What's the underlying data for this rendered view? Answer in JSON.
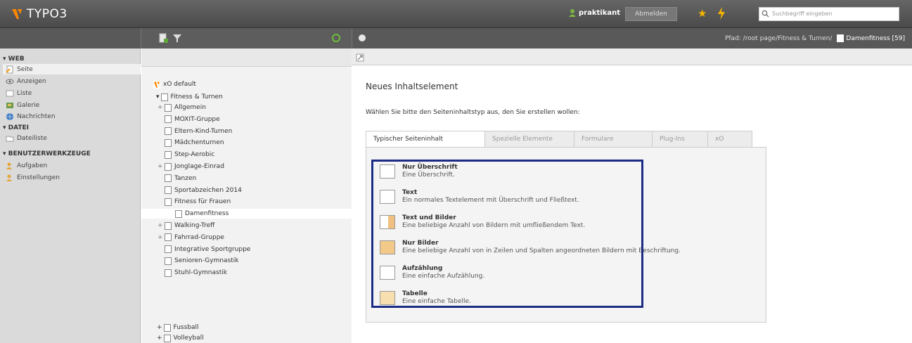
{
  "app": {
    "logo_text": "TYPO3",
    "user_name": "praktikant",
    "logout_label": "Abmelden",
    "search_placeholder": "Suchbegriff eingeben",
    "colors": {
      "topbar": "#4a4a4a",
      "accent": "#f5b400",
      "highlight": "#1b2c85"
    }
  },
  "path": {
    "label": "Pfad: /root page/Fitness & Turnen/",
    "page": "Damenfitness [59]"
  },
  "modules": {
    "web_section": "WEB",
    "web_items": [
      "Seite",
      "Anzeigen",
      "Liste",
      "Galerie",
      "Nachrichten"
    ],
    "files_section": "DATEI",
    "files_items": [
      "Dateiliste"
    ],
    "tools_section": "BENUTZERWERKZEUGE",
    "tools_items": [
      "Aufgaben",
      "Einstellungen"
    ]
  },
  "tree": {
    "root": "xO default",
    "parent": "Fitness & Turnen",
    "items": [
      "Allgemein",
      "MOXIT-Gruppe",
      "Eltern-Kind-Turnen",
      "Mädchenturnen",
      "Step-Aerobic",
      "Jonglage-Einrad",
      "Tanzen",
      "Sportabzeichen 2014",
      "Fitness für Frauen",
      "Damenfitness",
      "Walking-Treff",
      "Fahrrad-Gruppe",
      "Integrative Sportgruppe",
      "Senioren-Gymnastik",
      "Stuhl-Gymnastik"
    ],
    "siblings": [
      "Fussball",
      "Volleyball"
    ]
  },
  "content": {
    "title": "Neues Inhaltselement",
    "intro": "Wählen Sie bitte den Seiteninhaltstyp aus, den Sie erstellen wollen:",
    "tabs": [
      "Typischer Seiteninhalt",
      "Spezielle Elemente",
      "Formulare",
      "Plug-Ins",
      "xO"
    ],
    "elements": [
      {
        "name": "Nur Überschrift",
        "desc": "Eine Überschrift."
      },
      {
        "name": "Text",
        "desc": "Ein normales Textelement mit Überschrift und Fließtext."
      },
      {
        "name": "Text und Bilder",
        "desc": "Eine beliebige Anzahl von Bildern mit umfließendem Text."
      },
      {
        "name": "Nur Bilder",
        "desc": "Eine beliebige Anzahl von in Zeilen und Spalten angeordneten Bildern mit Beschriftung."
      },
      {
        "name": "Aufzählung",
        "desc": "Eine einfache Aufzählung."
      },
      {
        "name": "Tabelle",
        "desc": "Eine einfache Tabelle."
      }
    ]
  }
}
